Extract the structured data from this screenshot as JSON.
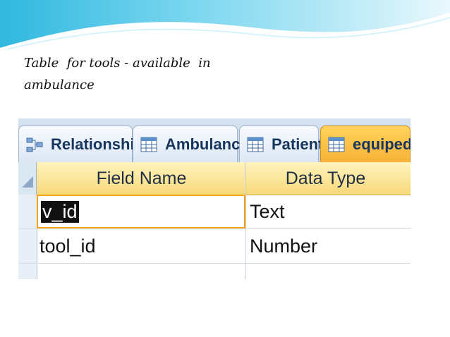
{
  "slide": {
    "caption_lines": [
      "Table  for tools - available  in",
      "ambulance"
    ]
  },
  "tabs": [
    {
      "label": "Relationships",
      "icon": "relationships-icon",
      "active": false
    },
    {
      "label": "Ambulance",
      "icon": "table-icon",
      "active": false
    },
    {
      "label": "Patient",
      "icon": "table-icon",
      "active": false
    },
    {
      "label": "equiped",
      "icon": "table-icon",
      "active": true
    }
  ],
  "table": {
    "columns": [
      "Field Name",
      "Data Type"
    ],
    "rows": [
      {
        "field_name": "v_id",
        "data_type": "Text",
        "selected_text": true
      },
      {
        "field_name": "tool_id",
        "data_type": "Number",
        "selected_text": false
      },
      {
        "field_name": "",
        "data_type": "",
        "selected_text": false
      }
    ]
  },
  "colors": {
    "slide_accent": "#5dc8ea",
    "active_tab": "#f8b237",
    "grid_header": "#f8d979"
  }
}
